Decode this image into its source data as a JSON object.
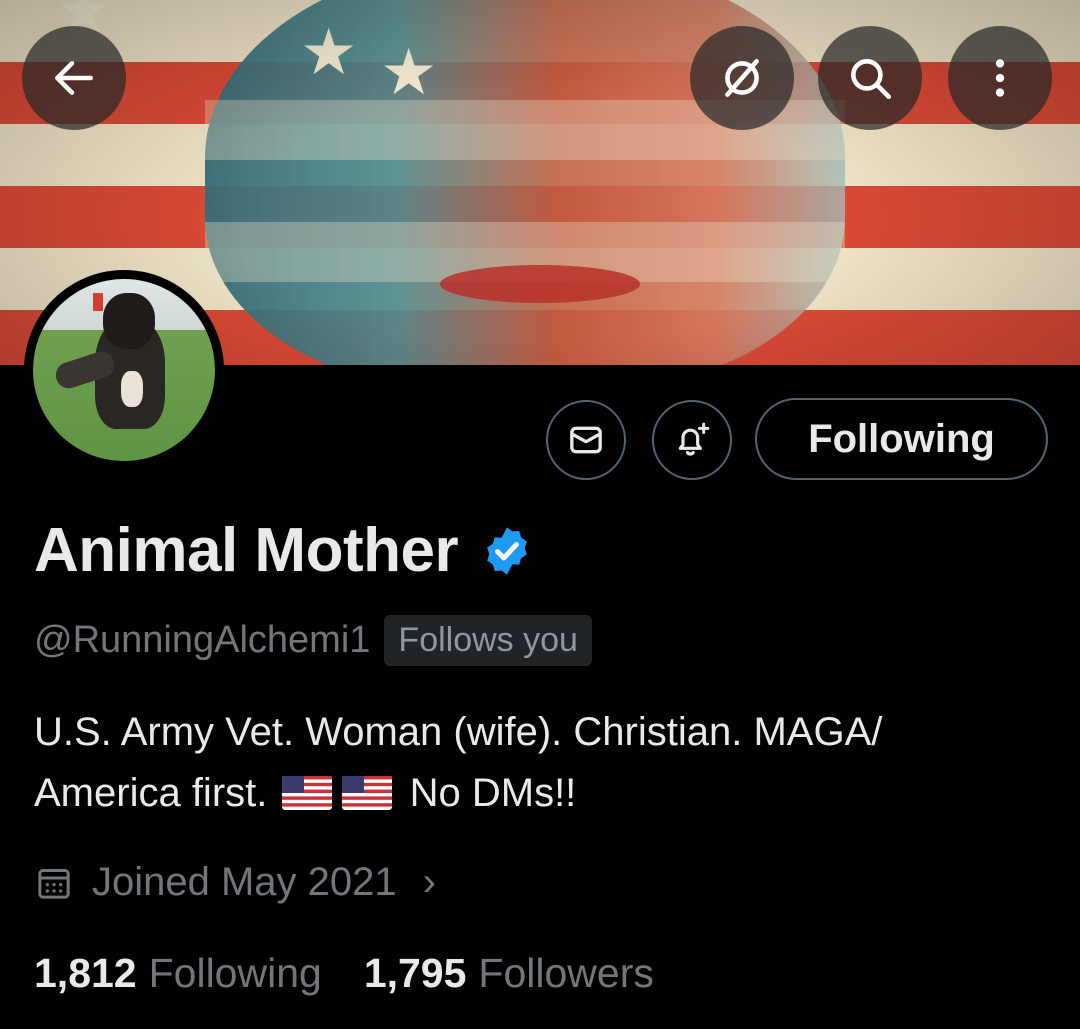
{
  "top_bar": {
    "back_icon": "arrow-left-icon",
    "grok_icon": "slashed-circle-icon",
    "search_icon": "search-icon",
    "more_icon": "vertical-dots-icon"
  },
  "profile": {
    "display_name": "Animal Mother",
    "verified": true,
    "verified_color": "#1d9bf0",
    "handle": "@RunningAlchemi1",
    "follows_you_label": "Follows you",
    "bio_part1": "U.S. Army Vet. Woman (wife). Christian. MAGA/",
    "bio_part2": "America first.",
    "bio_part3": "No DMs!!",
    "joined": "Joined May 2021",
    "following_count": "1,812",
    "following_label": "Following",
    "followers_count": "1,795",
    "followers_label": "Followers"
  },
  "actions": {
    "message_icon": "envelope-icon",
    "notify_icon": "bell-plus-icon",
    "following_button_label": "Following"
  },
  "colors": {
    "background": "#000000",
    "primary_text": "#e7e9ea",
    "secondary_text": "#71767b",
    "border": "#536471"
  }
}
